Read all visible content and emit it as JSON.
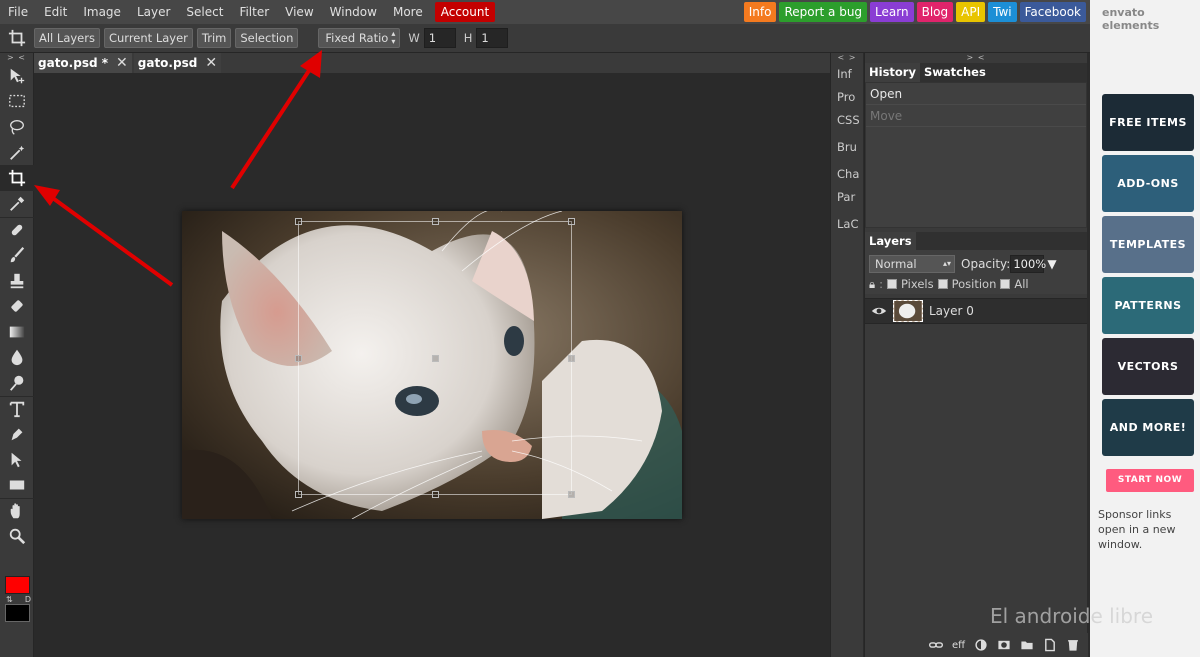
{
  "menu": {
    "items": [
      "File",
      "Edit",
      "Image",
      "Layer",
      "Select",
      "Filter",
      "View",
      "Window",
      "More"
    ],
    "account": "Account",
    "badges": [
      {
        "label": "Info",
        "color": "#f47a1f"
      },
      {
        "label": "Report a bug",
        "color": "#2c9e2c"
      },
      {
        "label": "Learn",
        "color": "#8a3dd4"
      },
      {
        "label": "Blog",
        "color": "#e0246b"
      },
      {
        "label": "API",
        "color": "#e8c400"
      },
      {
        "label": "Twi",
        "color": "#1c8fd6"
      },
      {
        "label": "Facebook",
        "color": "#3b5a9a"
      }
    ]
  },
  "options": {
    "buttons": [
      "All Layers",
      "Current Layer",
      "Trim",
      "Selection"
    ],
    "ratio_select": "Fixed Ratio",
    "w_label": "W",
    "w_value": "1",
    "h_label": "H",
    "h_value": "1"
  },
  "tabs": [
    {
      "label": "gato.psd *",
      "close": "✕"
    },
    {
      "label": "gato.psd",
      "close": "✕"
    }
  ],
  "mini_panel": [
    "Inf",
    "Pro",
    "CSS",
    "Bru",
    "Cha",
    "Par",
    "LaC"
  ],
  "history": {
    "tabs": [
      "History",
      "Swatches"
    ],
    "items": [
      "Open",
      "Move"
    ]
  },
  "layers": {
    "title": "Layers",
    "blend_mode": "Normal",
    "opacity_label": "Opacity:",
    "opacity_value": "100%",
    "lock_options": [
      "Pixels",
      "Position",
      "All"
    ],
    "layer_name": "Layer 0"
  },
  "collapse": {
    "left": "> <",
    "mini": "< >",
    "right": "> <"
  },
  "colors": {
    "foreground": "#ff0000",
    "background": "#000000",
    "accent_arrow": "#e00000"
  },
  "ad": {
    "logo": "envato elements",
    "tiles": [
      {
        "label": "FREE ITEMS",
        "color": "#1c2b36"
      },
      {
        "label": "ADD-ONS",
        "color": "#2d5f7a"
      },
      {
        "label": "TEMPLATES",
        "color": "#58708a"
      },
      {
        "label": "PATTERNS",
        "color": "#2c6a78"
      },
      {
        "label": "VECTORS",
        "color": "#2c2a33"
      },
      {
        "label": "AND MORE!",
        "color": "#1f3b48"
      }
    ],
    "cta": "START NOW",
    "note": "Sponsor links open in a new window."
  },
  "watermark": "El androide libre"
}
